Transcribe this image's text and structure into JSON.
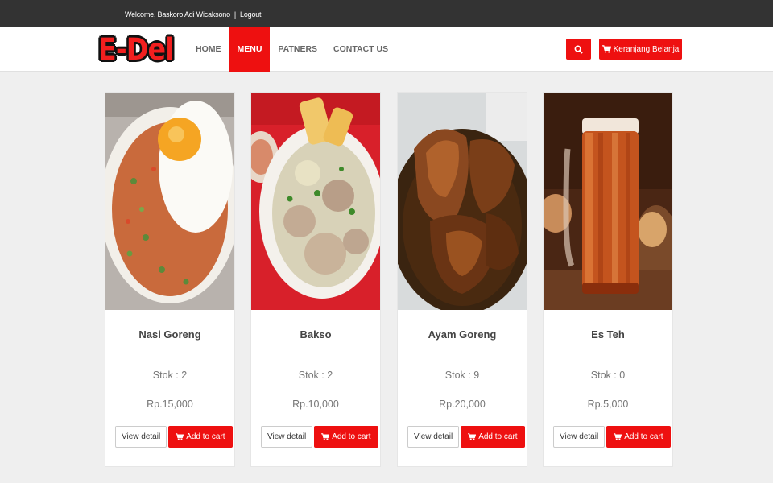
{
  "topbar": {
    "welcome_text": "Welcome, Baskoro Adi Wicaksono",
    "separator": "|",
    "logout_label": "Logout"
  },
  "brand": {
    "logo_text": "E-Del"
  },
  "nav": {
    "items": [
      {
        "label": "HOME",
        "active": false
      },
      {
        "label": "MENU",
        "active": true
      },
      {
        "label": "PATNERS",
        "active": false
      },
      {
        "label": "CONTACT US",
        "active": false
      }
    ]
  },
  "header_actions": {
    "search_icon": "search-icon",
    "cart_label": "Keranjang Belanja",
    "cart_icon": "shopping-cart-icon"
  },
  "colors": {
    "accent": "#ee1010",
    "topbar": "#333333",
    "page_bg": "#efefef"
  },
  "products": [
    {
      "name": "Nasi Goreng",
      "stock": "Stok : 2",
      "price": "Rp.15,000",
      "detail_label": "View detail",
      "add_label": "Add to cart"
    },
    {
      "name": "Bakso",
      "stock": "Stok : 2",
      "price": "Rp.10,000",
      "detail_label": "View detail",
      "add_label": "Add to cart"
    },
    {
      "name": "Ayam Goreng",
      "stock": "Stok : 9",
      "price": "Rp.20,000",
      "detail_label": "View detail",
      "add_label": "Add to cart"
    },
    {
      "name": "Es Teh",
      "stock": "Stok : 0",
      "price": "Rp.5,000",
      "detail_label": "View detail",
      "add_label": "Add to cart"
    }
  ]
}
